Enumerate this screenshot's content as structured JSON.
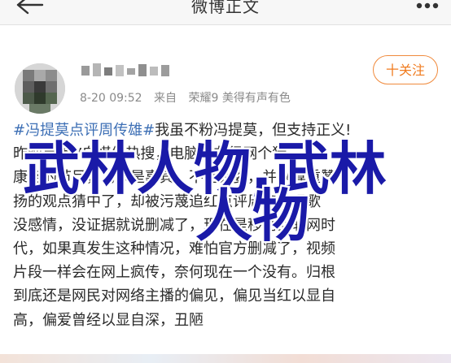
{
  "nav": {
    "title": "微博正文",
    "back_icon": "arrow-left-icon",
    "more_icon": "more-dots-icon"
  },
  "post": {
    "timestamp": "8-20 09:52",
    "source_prefix": "来自",
    "device": "荣耀9 美得有声有色",
    "follow_label": "十关注",
    "lines": [
      "#冯提莫点评周传雄#我虽不粉冯提莫，但支持正义!",
      "昨晚是大V自媒体热搜，电脑网友很网个猜",
      "康格的节目，冯兴是嘉宾，不是评委，并以尊重赞",
      "扬的观点猜中了，却被污蔑追红点评周传雄唱歌",
      "没感情，没证据就说删减了，现在是移动互联网时",
      "代，如果真发生这种情况，难怕官方删减了，视频",
      "片段一样会在网上疯传，奈何现在一个没有。归根",
      "到底还是网民对网络主播的偏见，偏见当红以显自",
      "高，偏爱曾经以显自深，丑陋"
    ],
    "hashtag": "#冯提莫点评周传雄#"
  },
  "watermark": {
    "line1": "武林人物,武林",
    "line2": "人物",
    "color": "#1a1aa8",
    "outline": "#ffffff"
  },
  "colors": {
    "accent": "#f07b1e",
    "link": "#3d6fb5"
  }
}
